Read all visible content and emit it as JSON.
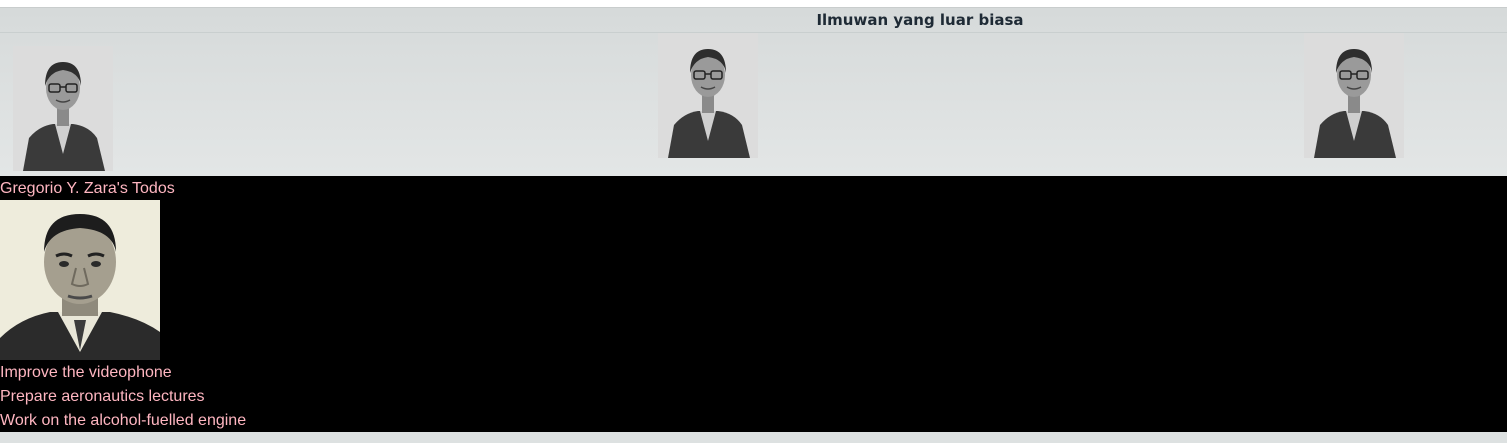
{
  "gallery": {
    "title": "Ilmuwan yang luar biasa",
    "portraits": [
      {
        "icon": "scientist-portrait-photo"
      },
      {
        "icon": "scientist-portrait-photo"
      },
      {
        "icon": "scientist-portrait-photo"
      }
    ]
  },
  "todos": {
    "heading": "Gregorio Y. Zara's Todos",
    "photo_icon": "gregorio-zara-portrait-photo",
    "text_color": "#ffb6c1",
    "background_color": "#000000",
    "items": [
      "Improve the videophone",
      "Prepare aeronautics lectures",
      "Work on the alcohol-fuelled engine"
    ]
  }
}
